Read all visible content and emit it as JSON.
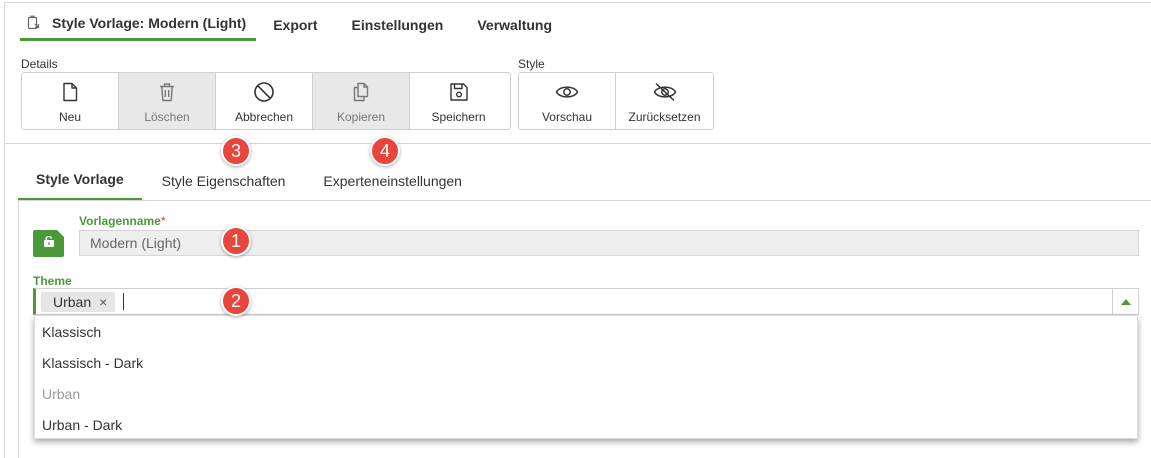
{
  "top_tabs": [
    {
      "label": "Style Vorlage: Modern (Light)"
    },
    {
      "label": "Export"
    },
    {
      "label": "Einstellungen"
    },
    {
      "label": "Verwaltung"
    }
  ],
  "toolbar": {
    "details_label": "Details",
    "style_label": "Style",
    "details_buttons": [
      {
        "label": "Neu",
        "icon": "new-document-icon",
        "disabled": false
      },
      {
        "label": "Löschen",
        "icon": "trash-icon",
        "disabled": true
      },
      {
        "label": "Abbrechen",
        "icon": "cancel-icon",
        "disabled": false
      },
      {
        "label": "Kopieren",
        "icon": "copy-icon",
        "disabled": true
      },
      {
        "label": "Speichern",
        "icon": "save-icon",
        "disabled": false
      }
    ],
    "style_buttons": [
      {
        "label": "Vorschau",
        "icon": "eye-icon"
      },
      {
        "label": "Zurücksetzen",
        "icon": "eye-off-icon"
      }
    ]
  },
  "sub_tabs": [
    {
      "label": "Style Vorlage"
    },
    {
      "label": "Style Eigenschaften"
    },
    {
      "label": "Experteneinstellungen"
    }
  ],
  "form": {
    "name_label": "Vorlagenname",
    "required_mark": "*",
    "name_value": "Modern (Light)",
    "theme_label": "Theme",
    "theme_selected": "Urban",
    "chip_remove": "×",
    "options": [
      "Klassisch",
      "Klassisch - Dark",
      "Urban",
      "Urban - Dark"
    ]
  },
  "badges": [
    "1",
    "2",
    "3",
    "4"
  ],
  "colors": {
    "accent": "#4a9a3a",
    "badge": "#e8453c",
    "required": "#d9342b"
  }
}
